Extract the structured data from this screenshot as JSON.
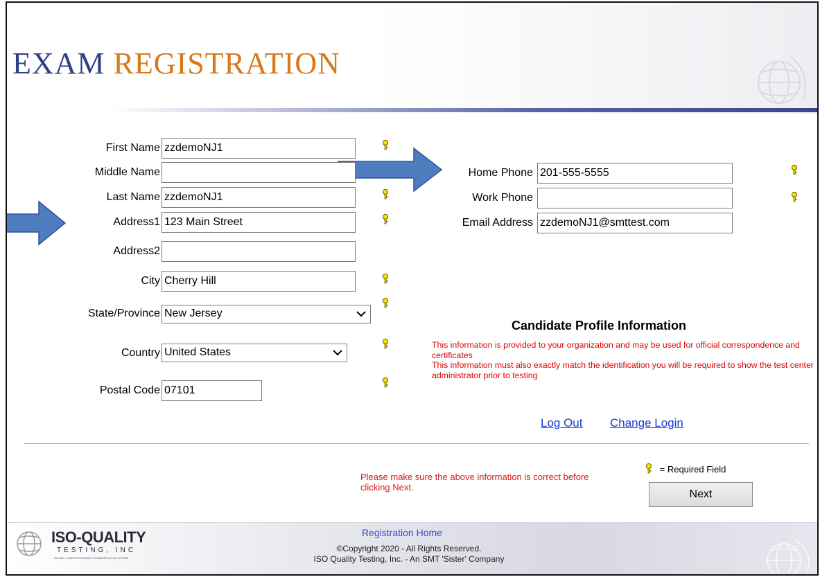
{
  "header": {
    "title_word1": "EXAM",
    "title_word2": "REGISTRATION"
  },
  "form_left": {
    "first_name": {
      "label": "First Name",
      "value": "zzdemoNJ1"
    },
    "middle_name": {
      "label": "Middle Name",
      "value": ""
    },
    "last_name": {
      "label": "Last Name",
      "value": "zzdemoNJ1"
    },
    "address1": {
      "label": "Address1",
      "value": "123 Main Street"
    },
    "address2": {
      "label": "Address2",
      "value": ""
    },
    "city": {
      "label": "City",
      "value": "Cherry Hill"
    },
    "state": {
      "label": "State/Province",
      "value": "New Jersey"
    },
    "country": {
      "label": "Country",
      "value": "United States"
    },
    "postal_code": {
      "label": "Postal Code",
      "value": "07101"
    }
  },
  "form_right": {
    "home_phone": {
      "label": "Home Phone",
      "value": "201-555-5555"
    },
    "work_phone": {
      "label": "Work Phone",
      "value": ""
    },
    "email": {
      "label": "Email Address",
      "value": "zzdemoNJ1@smttest.com"
    }
  },
  "profile": {
    "title": "Candidate Profile Information",
    "line1": "This information is provided to your organization and may be used for official correspondence and certificates",
    "line2": "This information must also exactly match the identification you will be required to show the test center administrator prior to testing"
  },
  "links": {
    "logout": "Log Out",
    "change_login": "Change Login"
  },
  "notice": "Please make sure the above information is correct before clicking Next.",
  "required_legend": "= Required Field",
  "next_button": "Next",
  "footer": {
    "logo_main": "ISO-QUALITY",
    "logo_sub": "TESTING, INC",
    "logo_tagline": "GLOBAL COMPUTER-BASED EXAMINATION SOLUTIONS",
    "home_link": "Registration Home",
    "copyright": "©Copyright 2020 - All Rights Reserved.",
    "company": "ISO Quality Testing, Inc. - An SMT 'Sister' Company"
  },
  "colors": {
    "title_blue": "#2f3f86",
    "title_orange": "#d97818",
    "required_key": "#f4e200",
    "arrow": "#4f7bbf",
    "link": "#1a3bd2",
    "alert_red": "#e00000"
  },
  "icons": [
    "key-icon",
    "arrow-icon",
    "chevron-down-icon",
    "globe-icon"
  ]
}
